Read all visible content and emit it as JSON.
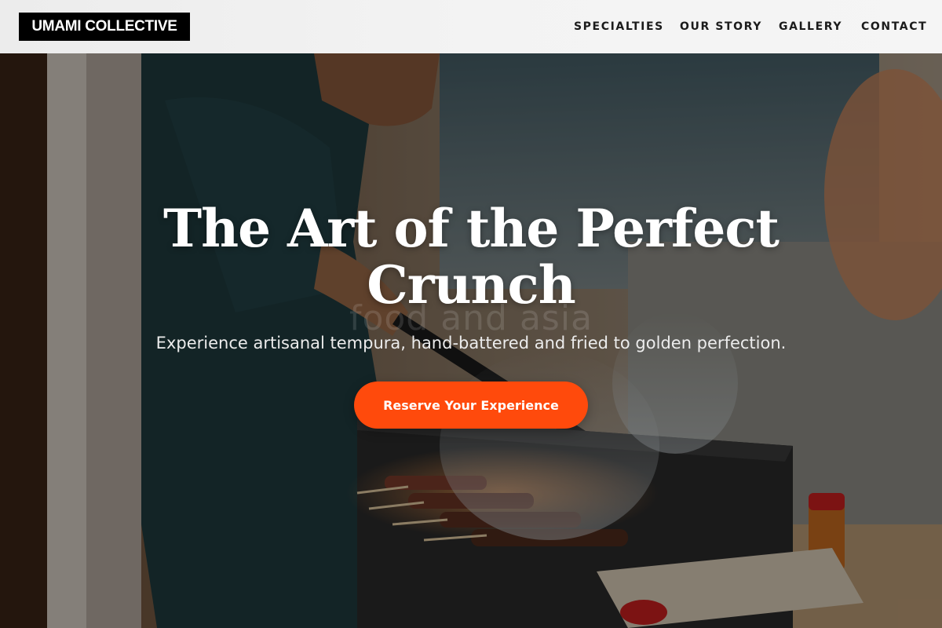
{
  "header": {
    "logo": "UMAMI COLLECTIVE",
    "nav": [
      {
        "label": "SPECIALTIES"
      },
      {
        "label": "OUR STORY"
      },
      {
        "label": "GALLERY"
      },
      {
        "label": "CONTACT"
      }
    ]
  },
  "hero": {
    "title": "The Art of the Perfect Crunch",
    "subtitle": "Experience artisanal tempura, hand-battered and fried to golden perfection.",
    "cta_label": "Reserve Your Experience",
    "watermark": "food and asia",
    "image_alt": "Chef grilling skewers over charcoal"
  },
  "colors": {
    "accent": "#ff4a0c",
    "logo_bg": "#000000",
    "header_bg": "#f2f2f2"
  }
}
